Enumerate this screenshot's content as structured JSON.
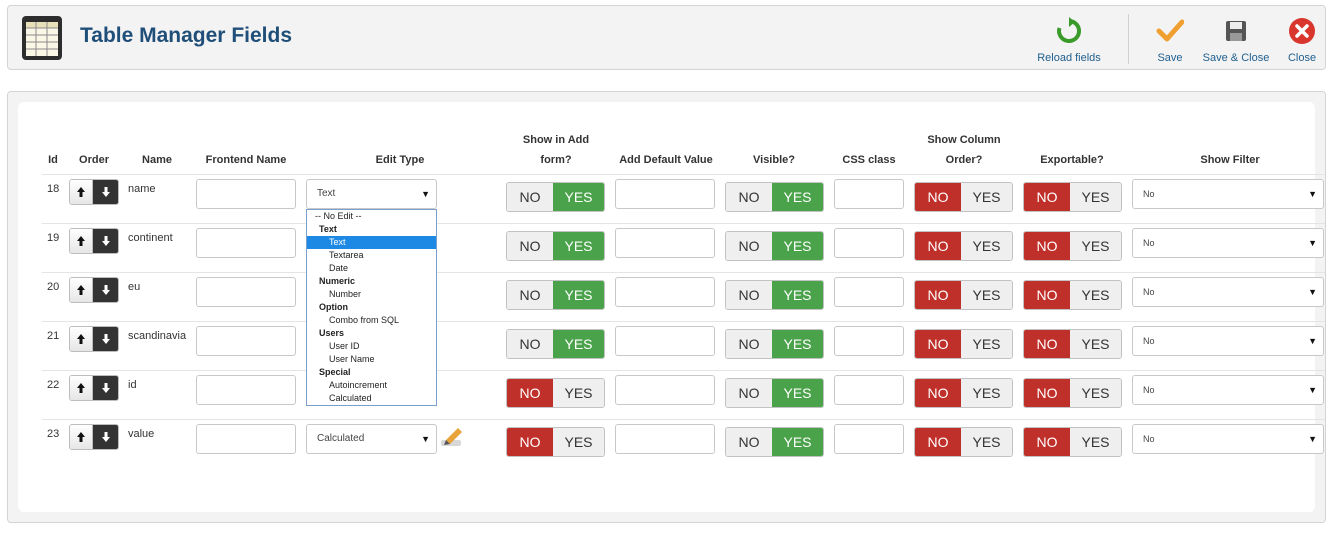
{
  "header": {
    "title": "Table Manager Fields",
    "buttons": {
      "reload": "Reload fields",
      "save": "Save",
      "save_close": "Save & Close",
      "close": "Close"
    }
  },
  "columns": {
    "id": "Id",
    "order": "Order",
    "name": "Name",
    "frontend_name": "Frontend Name",
    "edit_type": "Edit Type",
    "show_in_add_1": "Show in Add",
    "show_in_add_2": "form?",
    "add_default": "Add Default Value",
    "visible": "Visible?",
    "css_class": "CSS class",
    "show_col_order_1": "Show Column",
    "show_col_order_2": "Order?",
    "exportable": "Exportable?",
    "show_filter": "Show Filter"
  },
  "toggle_labels": {
    "no": "NO",
    "yes": "YES"
  },
  "rows": [
    {
      "id": "18",
      "name": "name",
      "edit_type": "Text",
      "filter": "No",
      "show_add": "YES",
      "visible": "YES",
      "col_order": "NO",
      "exportable": "NO"
    },
    {
      "id": "19",
      "name": "continent",
      "edit_type": "",
      "filter": "No",
      "show_add": "YES",
      "visible": "YES",
      "col_order": "NO",
      "exportable": "NO"
    },
    {
      "id": "20",
      "name": "eu",
      "edit_type": "",
      "filter": "No",
      "show_add": "YES",
      "visible": "YES",
      "col_order": "NO",
      "exportable": "NO"
    },
    {
      "id": "21",
      "name": "scandinavia",
      "edit_type": "",
      "filter": "No",
      "show_add": "YES",
      "visible": "YES",
      "col_order": "NO",
      "exportable": "NO"
    },
    {
      "id": "22",
      "name": "id",
      "edit_type": "",
      "filter": "No",
      "show_add": "NO",
      "visible": "YES",
      "col_order": "NO",
      "exportable": "NO"
    },
    {
      "id": "23",
      "name": "value",
      "edit_type": "Calculated",
      "filter": "No",
      "show_add": "NO",
      "visible": "YES",
      "col_order": "NO",
      "exportable": "NO"
    }
  ],
  "edit_type_options": [
    {
      "label": "-- No Edit --",
      "kind": "noedit"
    },
    {
      "label": "Text",
      "kind": "group"
    },
    {
      "label": "Text",
      "kind": "option",
      "selected": true
    },
    {
      "label": "Textarea",
      "kind": "option"
    },
    {
      "label": "Date",
      "kind": "option"
    },
    {
      "label": "Numeric",
      "kind": "group"
    },
    {
      "label": "Number",
      "kind": "option"
    },
    {
      "label": "Option",
      "kind": "group"
    },
    {
      "label": "Combo from SQL",
      "kind": "option"
    },
    {
      "label": "Users",
      "kind": "group"
    },
    {
      "label": "User ID",
      "kind": "option"
    },
    {
      "label": "User Name",
      "kind": "option"
    },
    {
      "label": "Special",
      "kind": "group"
    },
    {
      "label": "Autoincrement",
      "kind": "option"
    },
    {
      "label": "Calculated",
      "kind": "option"
    }
  ],
  "colors": {
    "yes_active": "#4aa24a",
    "no_active": "#c0302b",
    "title": "#1f4e79",
    "dropdown_selected": "#1e88e5"
  },
  "icons": {
    "app": "table-grid-icon",
    "reload": "refresh-icon",
    "save": "checkmark-icon",
    "save_close": "floppy-disk-icon",
    "close": "close-circle-icon",
    "edit": "pencil-icon"
  }
}
